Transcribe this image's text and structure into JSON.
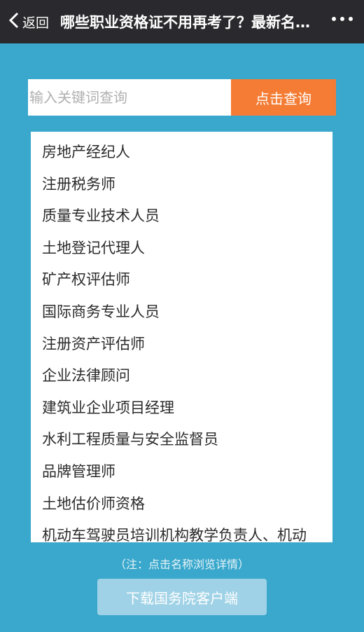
{
  "topbar": {
    "back_label": "返回",
    "title": "哪些职业资格证不用再考了？最新名单来了",
    "more_icon": "more-dots-icon"
  },
  "search": {
    "placeholder": "输入关键词查询",
    "value": "",
    "button_label": "点击查询"
  },
  "list": {
    "items": [
      "房地产经纪人",
      "注册税务师",
      "质量专业技术人员",
      "土地登记代理人",
      "矿产权评估师",
      "国际商务专业人员",
      "注册资产评估师",
      "企业法律顾问",
      "建筑业企业项目经理",
      "水利工程质量与安全监督员",
      "品牌管理师",
      "土地估价师资格",
      "机动车驾驶员培训机构教学负责人、机动"
    ]
  },
  "note": "（注：点击名称浏览详情）",
  "download_label": "下载国务院客户端",
  "colors": {
    "background": "#3aa8cc",
    "topbar": "#2a2a2e",
    "search_button": "#f47c34",
    "download_button": "#9fd2e6"
  }
}
